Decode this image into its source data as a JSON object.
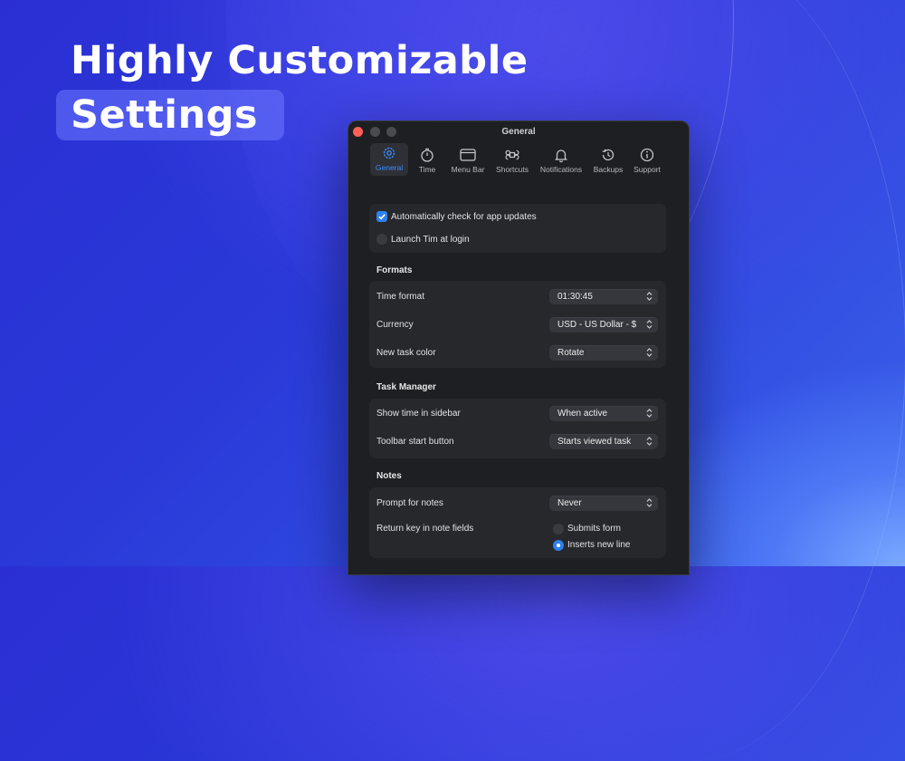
{
  "headline": {
    "line1": "Highly Customizable",
    "line2": "Settings"
  },
  "window": {
    "title": "General"
  },
  "toolbar": {
    "items": [
      {
        "label": "General",
        "icon": "gear-icon",
        "active": true
      },
      {
        "label": "Time",
        "icon": "stopwatch-icon"
      },
      {
        "label": "Menu Bar",
        "icon": "menubar-icon"
      },
      {
        "label": "Shortcuts",
        "icon": "command-icon"
      },
      {
        "label": "Notifications",
        "icon": "bell-icon"
      },
      {
        "label": "Backups",
        "icon": "history-icon"
      },
      {
        "label": "Support",
        "icon": "info-icon"
      }
    ]
  },
  "general": {
    "auto_update_label": "Automatically check for app updates",
    "auto_update_checked": true,
    "launch_login_label": "Launch Tim at login",
    "launch_login_checked": false
  },
  "formats": {
    "heading": "Formats",
    "time_format_label": "Time format",
    "time_format_value": "01:30:45",
    "currency_label": "Currency",
    "currency_value": "USD - US Dollar - $",
    "task_color_label": "New task color",
    "task_color_value": "Rotate"
  },
  "task_manager": {
    "heading": "Task Manager",
    "sidebar_time_label": "Show time in sidebar",
    "sidebar_time_value": "When active",
    "toolbar_start_label": "Toolbar start button",
    "toolbar_start_value": "Starts viewed task"
  },
  "notes": {
    "heading": "Notes",
    "prompt_label": "Prompt for notes",
    "prompt_value": "Never",
    "return_key_label": "Return key in note fields",
    "option_submit": "Submits form",
    "option_newline": "Inserts new line",
    "selected_option": "Inserts new line"
  },
  "colors": {
    "accent": "#2f80ed",
    "close": "#ff5f57",
    "window_bg": "#1e1f22",
    "card_bg": "#27282c"
  }
}
